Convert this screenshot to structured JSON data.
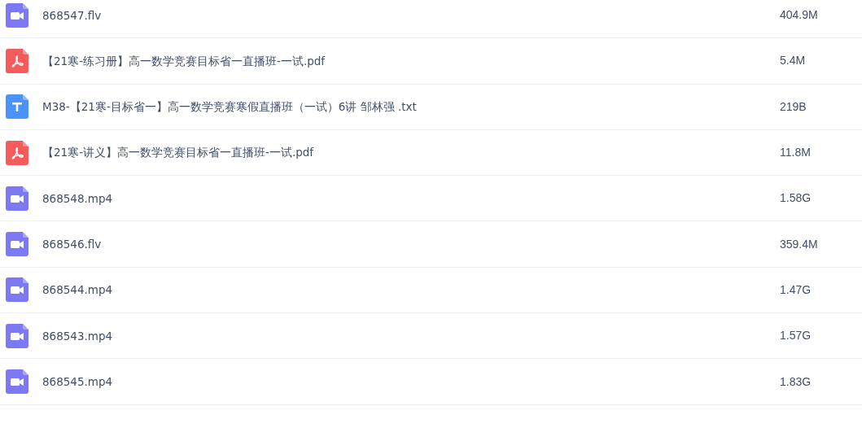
{
  "files": [
    {
      "kind": "video",
      "name": "868547.flv",
      "size": "404.9M"
    },
    {
      "kind": "pdf",
      "name": "【21寒-练习册】高一数学竞赛目标省一直播班-一试.pdf",
      "size": "5.4M"
    },
    {
      "kind": "text",
      "name": "M38-【21寒-目标省一】高一数学竞赛寒假直播班（一试）6讲 邹林强 .txt",
      "size": "219B"
    },
    {
      "kind": "pdf",
      "name": "【21寒-讲义】高一数学竞赛目标省一直播班-一试.pdf",
      "size": "11.8M"
    },
    {
      "kind": "video",
      "name": "868548.mp4",
      "size": "1.58G"
    },
    {
      "kind": "video",
      "name": "868546.flv",
      "size": "359.4M"
    },
    {
      "kind": "video",
      "name": "868544.mp4",
      "size": "1.47G"
    },
    {
      "kind": "video",
      "name": "868543.mp4",
      "size": "1.57G"
    },
    {
      "kind": "video",
      "name": "868545.mp4",
      "size": "1.83G"
    }
  ]
}
